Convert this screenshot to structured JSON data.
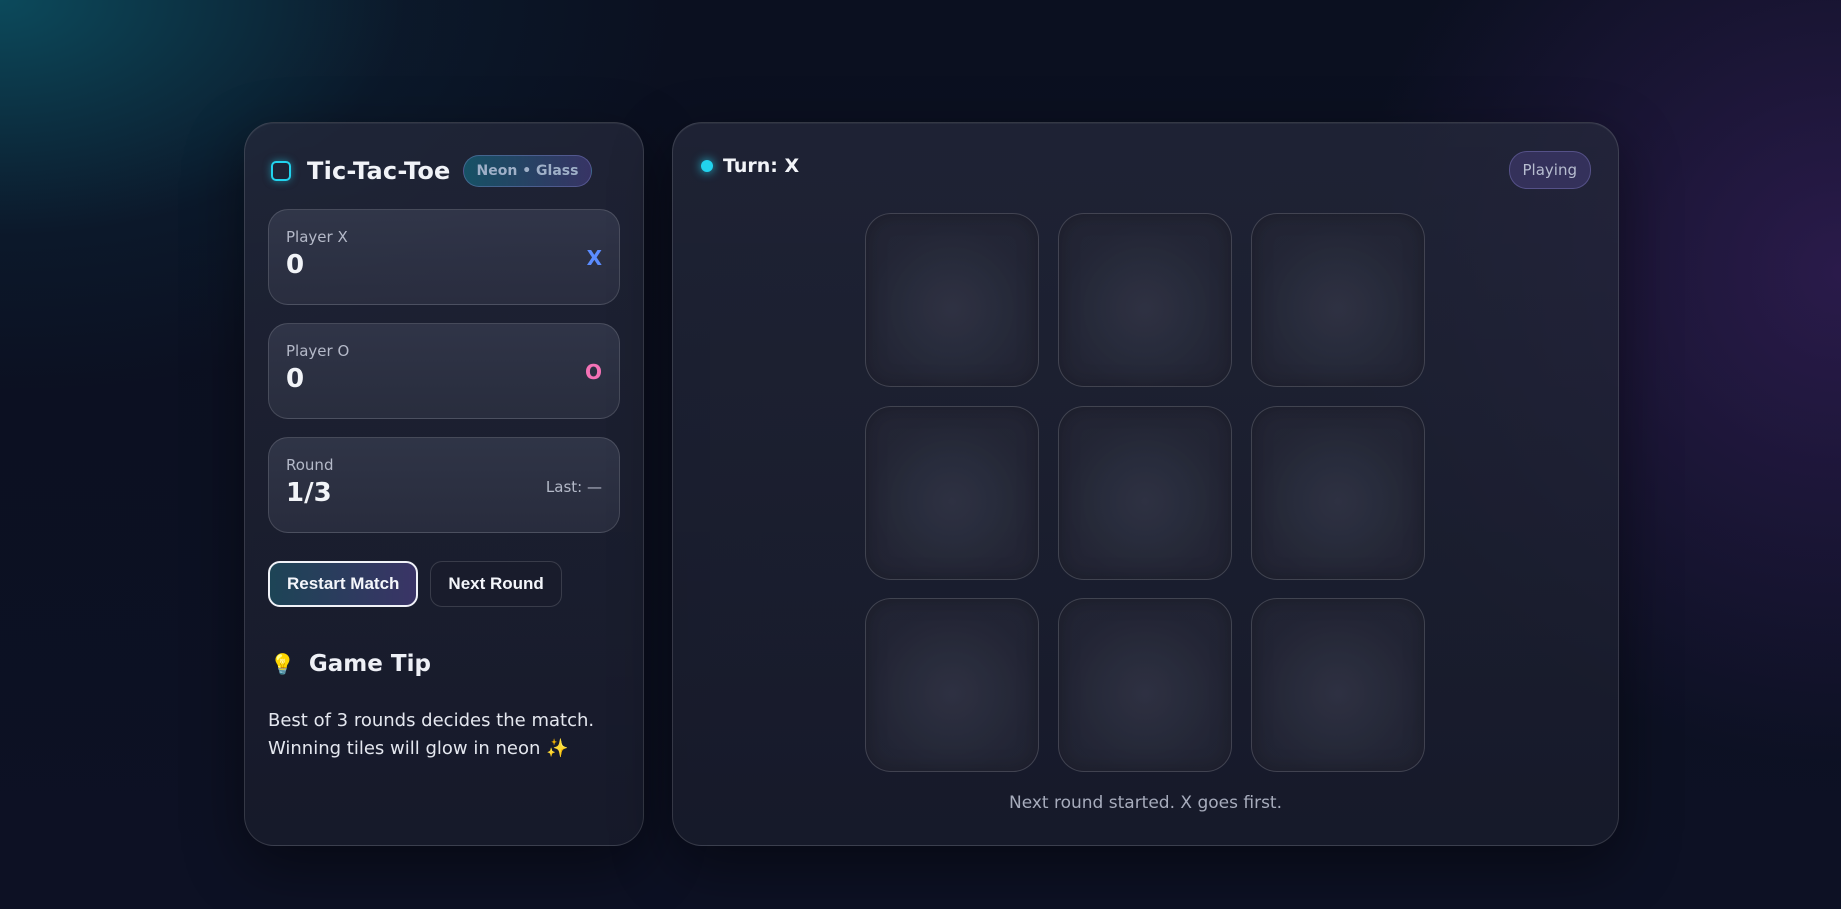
{
  "app": {
    "title": "Tic-Tac-Toe",
    "badge": "Neon • Glass"
  },
  "scoreboard": {
    "player_x": {
      "label": "Player X",
      "score": "0",
      "mark": "X"
    },
    "player_o": {
      "label": "Player O",
      "score": "0",
      "mark": "O"
    },
    "round": {
      "label": "Round",
      "value": "1/3",
      "last": "Last: —"
    }
  },
  "controls": {
    "restart_label": "Restart Match",
    "next_label": "Next Round"
  },
  "tip": {
    "icon": "lightbulb-icon",
    "heading": "Game Tip",
    "line1": "Best of 3 rounds decides the match.",
    "line2": "Winning tiles will glow in neon ✨"
  },
  "game": {
    "turn_text": "Turn: X",
    "status": "Playing",
    "message": "Next round started. X goes first.",
    "board": [
      "",
      "",
      "",
      "",
      "",
      "",
      "",
      "",
      ""
    ]
  },
  "colors": {
    "accent_cyan": "#22d3ee",
    "x_color": "#5b8cff",
    "o_color": "#f472b6"
  }
}
